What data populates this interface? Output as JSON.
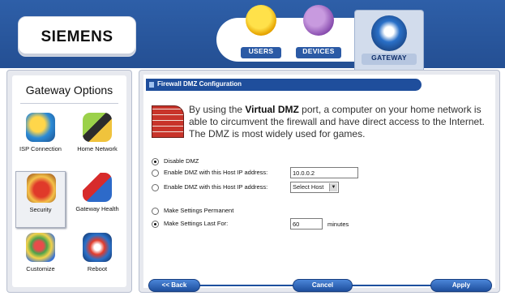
{
  "brand": {
    "name": "SIEMENS"
  },
  "top_tabs": [
    {
      "label": "USERS",
      "icon": "users-icon"
    },
    {
      "label": "DEVICES",
      "icon": "devices-icon"
    },
    {
      "label": "GATEWAY",
      "icon": "gateway-icon",
      "selected": true
    }
  ],
  "sidebar": {
    "title": "Gateway Options",
    "items": [
      {
        "label": "ISP Connection",
        "icon": "isp-connection-icon"
      },
      {
        "label": "Home Network",
        "icon": "home-network-icon"
      },
      {
        "label": "Security",
        "icon": "security-icon",
        "selected": true
      },
      {
        "label": "Gateway Health",
        "icon": "gateway-health-icon"
      },
      {
        "label": "Customize",
        "icon": "customize-icon"
      },
      {
        "label": "Reboot",
        "icon": "reboot-icon"
      }
    ]
  },
  "main": {
    "section_title": "Firewall DMZ Configuration",
    "intro": {
      "prefix": "By using the ",
      "bold": "Virtual DMZ",
      "suffix": " port, a computer on your home network is able to circumvent the firewall and have direct access to the Internet. The DMZ is most widely used for games."
    },
    "dmz_options": [
      {
        "label": "Disable DMZ",
        "selected": true
      },
      {
        "label": "Enable DMZ with this Host IP address:",
        "selected": false,
        "value": "10.0.0.2"
      },
      {
        "label": "Enable DMZ with this Host IP address:",
        "selected": false,
        "select_value": "Select Host"
      }
    ],
    "duration_options": [
      {
        "label": "Make Settings Permanent",
        "selected": false
      },
      {
        "label": "Make Settings Last For:",
        "selected": true,
        "value": "60",
        "unit": "minutes"
      }
    ],
    "buttons": {
      "back": "<< Back",
      "cancel": "Cancel",
      "apply": "Apply"
    }
  },
  "colors": {
    "header": "#2e5fa8",
    "accent": "#1f4e9c",
    "panel": "#e7e9ef"
  }
}
